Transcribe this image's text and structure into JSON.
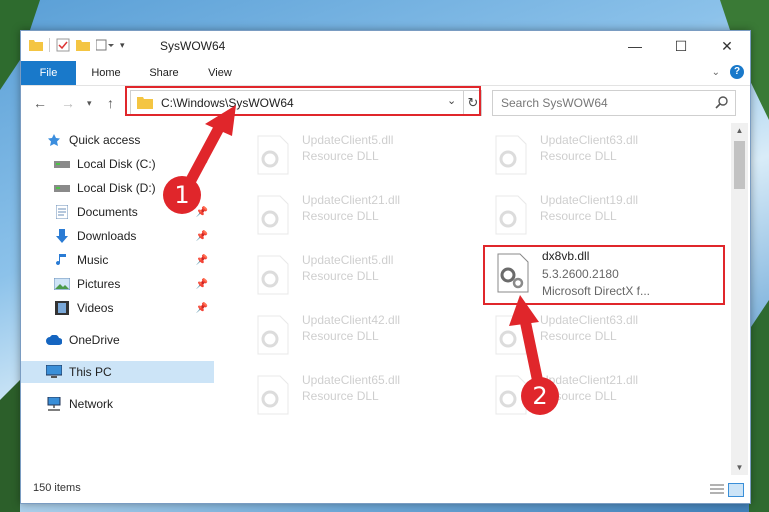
{
  "window": {
    "title": "SysWOW64"
  },
  "ribbon": {
    "tabs": [
      "File",
      "Home",
      "Share",
      "View"
    ]
  },
  "address": {
    "path": "C:\\Windows\\SysWOW64"
  },
  "search": {
    "placeholder": "Search SysWOW64"
  },
  "sidebar": {
    "items": [
      {
        "label": "Quick access",
        "icon": "star-icon"
      },
      {
        "label": "Local Disk (C:)",
        "icon": "drive-icon"
      },
      {
        "label": "Local Disk (D:)",
        "icon": "drive-icon"
      },
      {
        "label": "Documents",
        "icon": "documents-icon"
      },
      {
        "label": "Downloads",
        "icon": "download-icon"
      },
      {
        "label": "Music",
        "icon": "music-icon"
      },
      {
        "label": "Pictures",
        "icon": "pictures-icon"
      },
      {
        "label": "Videos",
        "icon": "videos-icon"
      },
      {
        "label": "OneDrive",
        "icon": "cloud-icon"
      },
      {
        "label": "This PC",
        "icon": "computer-icon"
      },
      {
        "label": "Network",
        "icon": "network-icon"
      }
    ]
  },
  "files": [
    {
      "name": "UpdateClient5.dll",
      "desc": "Resource DLL"
    },
    {
      "name": "UpdateClient63.dll",
      "desc": "Resource DLL"
    },
    {
      "name": "UpdateClient21.dll",
      "desc": "Resource DLL"
    },
    {
      "name": "UpdateClient19.dll",
      "desc": "Resource DLL"
    },
    {
      "name": "UpdateClient5.dll",
      "desc": "Resource DLL"
    },
    {
      "name": "dx8vb.dll",
      "version": "5.3.2600.2180",
      "desc": "Microsoft DirectX f..."
    },
    {
      "name": "UpdateClient42.dll",
      "desc": "Resource DLL"
    },
    {
      "name": "UpdateClient63.dll",
      "desc": "Resource DLL"
    },
    {
      "name": "UpdateClient65.dll",
      "desc": "Resource DLL"
    },
    {
      "name": "UpdateClient21.dll",
      "desc": "Resource DLL"
    }
  ],
  "status": {
    "count": "150 items"
  },
  "annotations": {
    "step1": "1",
    "step2": "2"
  },
  "colors": {
    "accent": "#1979ca",
    "highlight": "#e0262b",
    "selected": "#cce4f7"
  }
}
